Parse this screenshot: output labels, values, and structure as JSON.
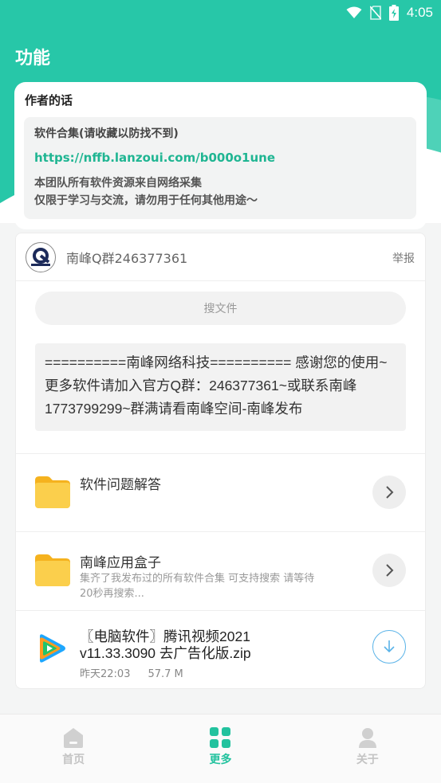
{
  "status_bar": {
    "time": "4:05"
  },
  "page": {
    "title": "功能"
  },
  "author_card": {
    "title": "作者的话",
    "line1": "软件合集(请收藏以防找不到)",
    "link": "https://nffb.lanzoui.com/b000o1une",
    "line3": "本团队所有软件资源来自网络采集",
    "line4": "仅限于学习与交流，请勿用于任何其他用途～"
  },
  "share": {
    "owner_name": "南峰Q群246377361",
    "report_label": "举报",
    "search_placeholder": "搜文件",
    "description": "==========南峰网络科技========== 感谢您的使用~更多软件请加入官方Q群：246377361~或联系南峰1773799299~群满请看南峰空间-南峰发布"
  },
  "items": [
    {
      "title": "软件问题解答",
      "subtitle": ""
    },
    {
      "title": "南峰应用盒子",
      "subtitle": "集齐了我发布过的所有软件合集 可支持搜索 请等待20秒再搜索..."
    }
  ],
  "file": {
    "title": "〖电脑软件〗腾讯视频2021 v11.33.3090 去广告化版.zip",
    "date": "昨天22:03",
    "size": "57.7 M"
  },
  "nav": {
    "home": "首页",
    "more": "更多",
    "about": "关于"
  },
  "colors": {
    "accent": "#27c7a8",
    "link": "#1fb592",
    "folder": "#f9c12d"
  }
}
